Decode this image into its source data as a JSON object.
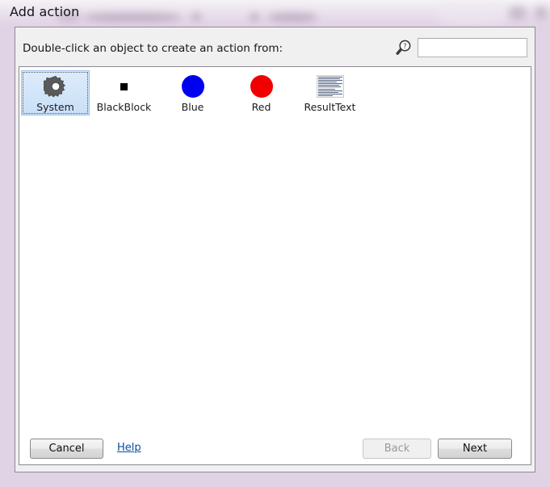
{
  "window": {
    "title": "Add action",
    "accent_glass": "#e0d2e4"
  },
  "dialog": {
    "instruction": "Double-click an object to create an action from:"
  },
  "search": {
    "icon": "magnifier-question-icon",
    "value": "",
    "placeholder": ""
  },
  "object_list": {
    "items": [
      {
        "label": "System",
        "icon": "gear-icon",
        "color": "#575757",
        "selected": true
      },
      {
        "label": "BlackBlock",
        "icon": "black-square-icon",
        "color": "#000000",
        "selected": false
      },
      {
        "label": "Blue",
        "icon": "blue-circle-icon",
        "color": "#0000f0",
        "selected": false
      },
      {
        "label": "Red",
        "icon": "red-circle-icon",
        "color": "#f00000",
        "selected": false
      },
      {
        "label": "ResultText",
        "icon": "text-thumbnail-icon",
        "color": "#5a6a86",
        "selected": false
      }
    ]
  },
  "footer": {
    "cancel_label": "Cancel",
    "help_label": "Help",
    "back_label": "Back",
    "next_label": "Next",
    "back_disabled": true,
    "link_color": "#0b4da2"
  }
}
